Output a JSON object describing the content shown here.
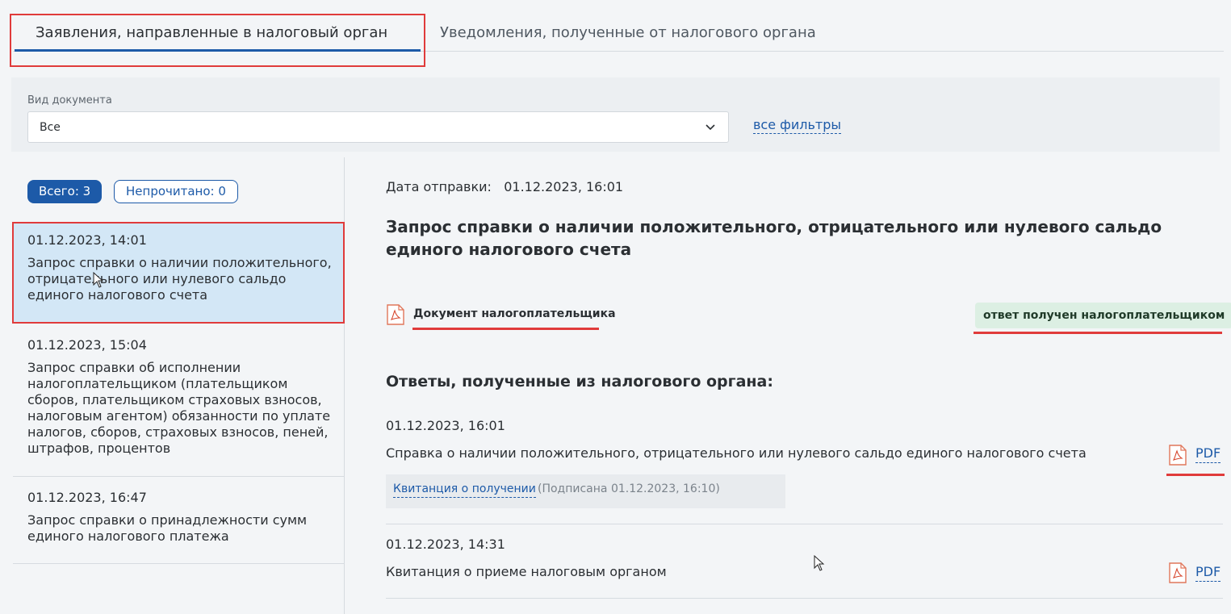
{
  "tabs": {
    "active": "Заявления, направленные в налоговый орган",
    "inactive": "Уведомления, полученные от налогового органа"
  },
  "filter": {
    "label": "Вид документа",
    "value": "Все",
    "all_filters": "все фильтры"
  },
  "counters": {
    "total": "Всего: 3",
    "unread": "Непрочитано: 0"
  },
  "list": [
    {
      "date": "01.12.2023, 14:01",
      "title": "Запрос справки о наличии положительного, отрицательного или нулевого сальдо единого налогового счета"
    },
    {
      "date": "01.12.2023, 15:04",
      "title": "Запрос  справки об исполнении налогоплательщиком (плательщиком сборов, плательщиком страховых взносов, налоговым агентом) обязанности по уплате налогов, сборов, страховых взносов, пеней, штрафов, процентов"
    },
    {
      "date": "01.12.2023, 16:47",
      "title": "Запрос справки о принадлежности сумм единого налогового платежа"
    }
  ],
  "detail": {
    "send_label": "Дата отправки:",
    "send_date": "01.12.2023, 16:01",
    "title": "Запрос справки о наличии положительного, отрицательного или нулевого сальдо единого налогового счета",
    "doc_link": "Документ налогоплательщика",
    "status": "ответ получен налогоплательщиком",
    "answers_title": "Ответы, полученные из налогового органа:",
    "answers": [
      {
        "date": "01.12.2023, 16:01",
        "text": "Справка о наличии положительного, отрицательного или нулевого сальдо единого налогового счета",
        "pdf": "PDF",
        "receipt_link": "Квитанция о получении",
        "receipt_meta": "(Подписана 01.12.2023, 16:10)"
      },
      {
        "date": "01.12.2023, 14:31",
        "text": "Квитанция о приеме налоговым органом",
        "pdf": "PDF"
      }
    ]
  },
  "colors": {
    "accent": "#1d5aa8",
    "highlight": "#e03b3b",
    "selected_bg": "#d3e7f6",
    "status_bg": "#dcefe3"
  },
  "icons": [
    "chevron-down-icon",
    "pdf-icon",
    "mouse-pointer-icon"
  ]
}
